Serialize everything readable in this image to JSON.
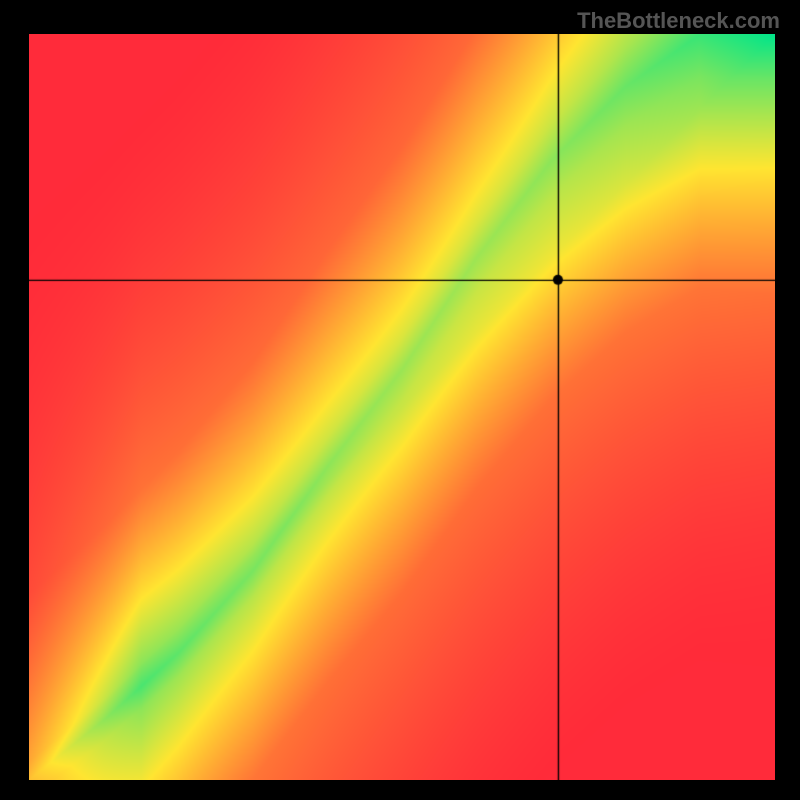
{
  "watermark": "TheBottleneck.com",
  "chart_data": {
    "type": "heatmap",
    "title": "",
    "xlabel": "",
    "ylabel": "",
    "xlim": [
      0,
      1
    ],
    "ylim": [
      0,
      1
    ],
    "crosshair": {
      "x": 0.71,
      "y": 0.67
    },
    "marker": {
      "x": 0.71,
      "y": 0.67
    },
    "color_scale": {
      "min_color": "#ff2b3a",
      "mid_color": "#ffe531",
      "max_color": "#00e58a",
      "description": "Red = poor balance (bottleneck), green = optimal match along the diagonal/curve"
    },
    "green_ridge_samples": [
      {
        "x": 0.0,
        "y": 0.0
      },
      {
        "x": 0.1,
        "y": 0.08
      },
      {
        "x": 0.2,
        "y": 0.17
      },
      {
        "x": 0.3,
        "y": 0.28
      },
      {
        "x": 0.4,
        "y": 0.42
      },
      {
        "x": 0.5,
        "y": 0.55
      },
      {
        "x": 0.6,
        "y": 0.7
      },
      {
        "x": 0.7,
        "y": 0.83
      },
      {
        "x": 0.8,
        "y": 0.93
      },
      {
        "x": 0.9,
        "y": 1.0
      }
    ]
  }
}
